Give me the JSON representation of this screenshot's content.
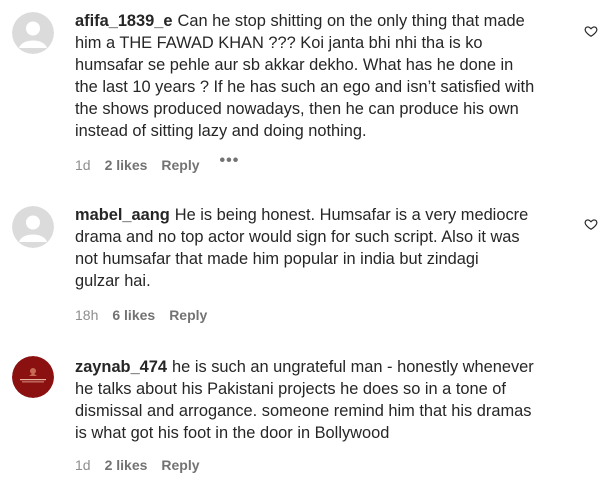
{
  "comments": [
    {
      "username": "afifa_1839_e",
      "lines": [
        "Can he stop shitting on the only thing that made",
        "him a THE FAWAD KHAN ??? Koi janta bhi nhi tha is ko",
        "humsafar se pehle aur sb akkar dekho. What has he done in",
        "the last 10 years ? If he has such an ego and isn’t satisfied with",
        "the shows produced nowadays, then he can produce his own",
        "instead of sitting lazy and doing nothing."
      ],
      "time": "1d",
      "likes": "2 likes",
      "reply": "Reply",
      "more": "•••",
      "avatar": "default-avatar-icon"
    },
    {
      "username": "mabel_aang",
      "lines": [
        "He is being honest. Humsafar is a very mediocre",
        "drama and no top actor would sign for such script. Also it was",
        "not humsafar that made him popular in india but zindagi",
        "gulzar hai."
      ],
      "time": "18h",
      "likes": "6 likes",
      "reply": "Reply",
      "avatar": "default-avatar-icon"
    },
    {
      "username": "zaynab_474",
      "lines": [
        "he is such an ungrateful man - honestly whenever",
        "he talks about his Pakistani projects he does so in a tone of",
        "dismissal and arrogance. someone remind him that his dramas",
        "is what got his foot in the door in Bollywood"
      ],
      "time": "1d",
      "likes": "2 likes",
      "reply": "Reply",
      "avatar": "brand-logo-avatar"
    }
  ],
  "colors": {
    "text": "#262626",
    "meta": "#8e8e8e",
    "avatar_default": "#dbdbdb",
    "avatar_brand": "#8b1010"
  }
}
